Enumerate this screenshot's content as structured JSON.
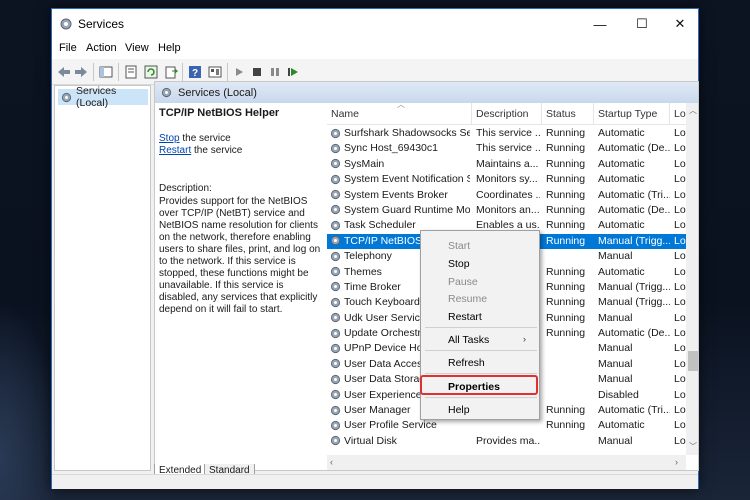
{
  "window": {
    "title": "Services",
    "controls": {
      "minimize": "—",
      "maximize": "☐",
      "close": "✕"
    }
  },
  "menu": [
    "File",
    "Action",
    "View",
    "Help"
  ],
  "tree": {
    "item": "Services (Local)"
  },
  "main_header": "Services (Local)",
  "description_pane": {
    "title": "TCP/IP NetBIOS Helper",
    "stop_link": "Stop",
    "stop_suffix": " the service",
    "restart_link": "Restart",
    "restart_suffix": " the service",
    "label": "Description:",
    "text": "Provides support for the NetBIOS over TCP/IP (NetBT) service and NetBIOS name resolution for clients on the network, therefore enabling users to share files, print, and log on to the network. If this service is stopped, these functions might be unavailable. If this service is disabled, any services that explicitly depend on it will fail to start."
  },
  "columns": {
    "name": "Name",
    "description": "Description",
    "status": "Status",
    "startup": "Startup Type",
    "logon": "Log"
  },
  "rows": [
    {
      "name": "Surfshark Shadowsocks Serv...",
      "description": "This service ...",
      "status": "Running",
      "startup": "Automatic",
      "logon": "Loc"
    },
    {
      "name": "Sync Host_69430c1",
      "description": "This service ...",
      "status": "Running",
      "startup": "Automatic (De...",
      "logon": "Loc"
    },
    {
      "name": "SysMain",
      "description": "Maintains a...",
      "status": "Running",
      "startup": "Automatic",
      "logon": "Loc"
    },
    {
      "name": "System Event Notification S...",
      "description": "Monitors sy...",
      "status": "Running",
      "startup": "Automatic",
      "logon": "Loc"
    },
    {
      "name": "System Events Broker",
      "description": "Coordinates ...",
      "status": "Running",
      "startup": "Automatic (Tri...",
      "logon": "Loc"
    },
    {
      "name": "System Guard Runtime Mon...",
      "description": "Monitors an...",
      "status": "Running",
      "startup": "Automatic (De...",
      "logon": "Loc"
    },
    {
      "name": "Task Scheduler",
      "description": "Enables a us...",
      "status": "Running",
      "startup": "Automatic",
      "logon": "Loc"
    },
    {
      "name": "TCP/IP NetBIOS Helper",
      "description": "Provides su...",
      "status": "Running",
      "startup": "Manual (Trigg...",
      "logon": "Loc",
      "selected": true
    },
    {
      "name": "Telephony",
      "description": "",
      "status": "",
      "startup": "Manual",
      "logon": "Loc"
    },
    {
      "name": "Themes",
      "description": "",
      "status": "Running",
      "startup": "Automatic",
      "logon": "Loc"
    },
    {
      "name": "Time Broker",
      "description": "",
      "status": "Running",
      "startup": "Manual (Trigg...",
      "logon": "Loc"
    },
    {
      "name": "Touch Keyboard and ...",
      "description": "",
      "status": "Running",
      "startup": "Manual (Trigg...",
      "logon": "Loc"
    },
    {
      "name": "Udk User Service_6...",
      "description": "",
      "status": "Running",
      "startup": "Manual",
      "logon": "Loc"
    },
    {
      "name": "Update Orchestrat...",
      "description": "",
      "status": "Running",
      "startup": "Automatic (De...",
      "logon": "Loc"
    },
    {
      "name": "UPnP Device Host",
      "description": "",
      "status": "",
      "startup": "Manual",
      "logon": "Loc"
    },
    {
      "name": "User Data Access_6...",
      "description": "",
      "status": "",
      "startup": "Manual",
      "logon": "Loc"
    },
    {
      "name": "User Data Storage_...",
      "description": "",
      "status": "",
      "startup": "Manual",
      "logon": "Loc"
    },
    {
      "name": "User Experience Vir...",
      "description": "",
      "status": "",
      "startup": "Disabled",
      "logon": "Loc"
    },
    {
      "name": "User Manager",
      "description": "",
      "status": "Running",
      "startup": "Automatic (Tri...",
      "logon": "Loc"
    },
    {
      "name": "User Profile Service",
      "description": "",
      "status": "Running",
      "startup": "Automatic",
      "logon": "Loc"
    },
    {
      "name": "Virtual Disk",
      "description": "Provides ma...",
      "status": "",
      "startup": "Manual",
      "logon": "Loc"
    }
  ],
  "context_menu": {
    "start": "Start",
    "stop": "Stop",
    "pause": "Pause",
    "resume": "Resume",
    "restart": "Restart",
    "all_tasks": "All Tasks",
    "submenu_arrow": "›",
    "refresh": "Refresh",
    "properties": "Properties",
    "help": "Help"
  },
  "tabs": {
    "extended": "Extended",
    "standard": "Standard"
  },
  "colors": {
    "selection": "#0078d7",
    "highlight_box": "#e03030",
    "header_accent": "#2d6bb8"
  }
}
